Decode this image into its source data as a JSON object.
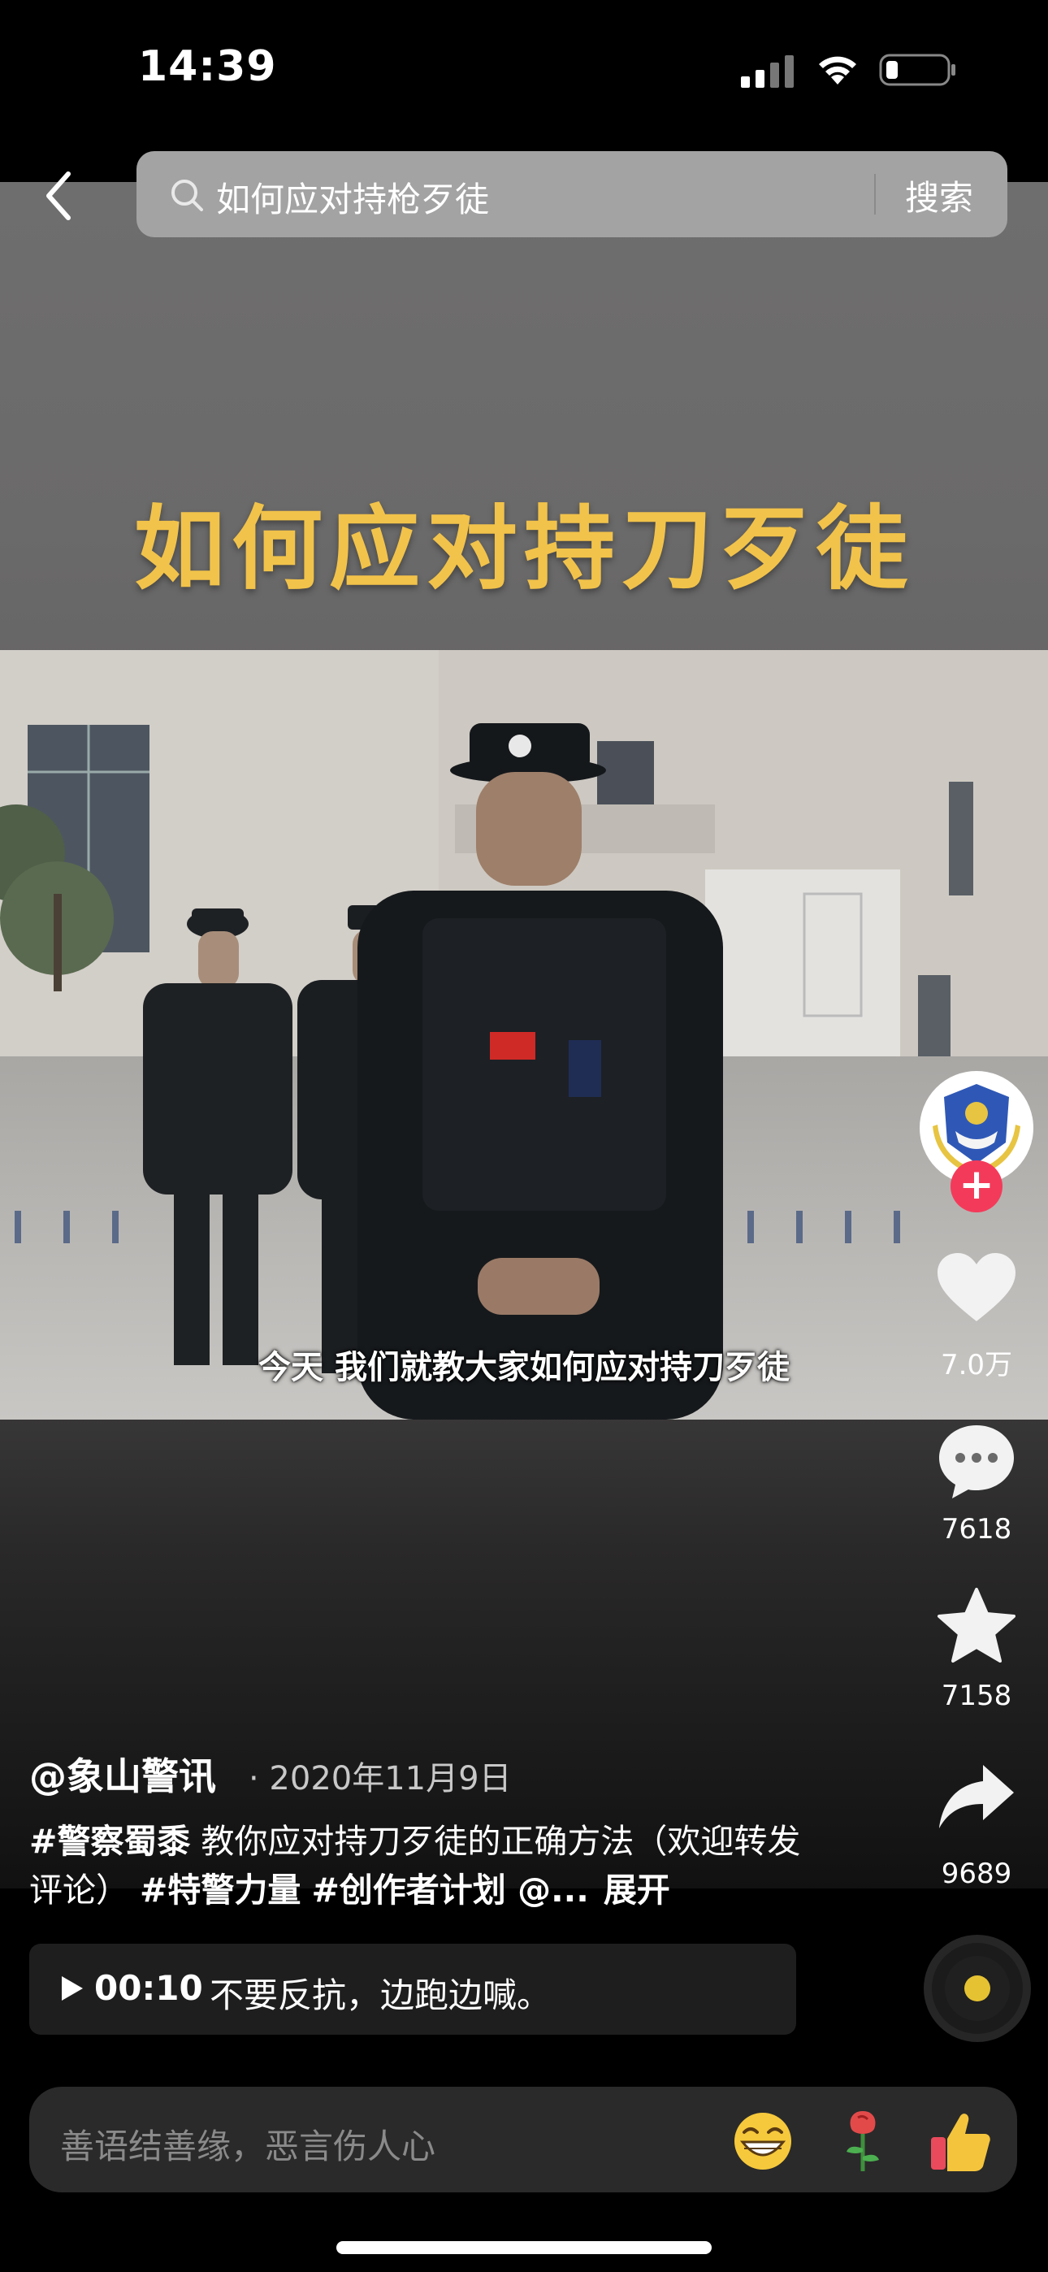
{
  "status_bar": {
    "time": "14:39"
  },
  "search": {
    "query": "如何应对持枪歹徒",
    "button_label": "搜索"
  },
  "video": {
    "title_overlay": "如何应对持刀歹徒",
    "caption": "今天 我们就教大家如何应对持刀歹徒"
  },
  "actions": {
    "follow_label": "+",
    "like_count": "7.0万",
    "comment_count": "7618",
    "favorite_count": "7158",
    "share_count": "9689"
  },
  "post": {
    "author": "@象山警讯",
    "date": "· 2020年11月9日",
    "tag1": "#警察蜀黍",
    "text1": " 教你应对持刀歹徒的正确方法（欢迎转发评论） ",
    "tag2": "#特警力量",
    "tag3": "#创作者计划",
    "mention": " @...",
    "expand_label": "展开"
  },
  "chapter": {
    "time": "00:10",
    "text": "不要反抗，边跑边喊。"
  },
  "comment_input": {
    "placeholder": "善语结善缘，恶言伤人心"
  },
  "colors": {
    "title_yellow": "#f2c34a",
    "follow_red": "#f43a5a",
    "search_bg": "#a3a3a3"
  },
  "icons": [
    "back-icon",
    "search-icon",
    "heart-icon",
    "comment-icon",
    "star-icon",
    "share-icon",
    "play-icon",
    "music-disc-icon",
    "grin-emoji-icon",
    "rose-emoji-icon",
    "thumbs-up-emoji-icon"
  ]
}
